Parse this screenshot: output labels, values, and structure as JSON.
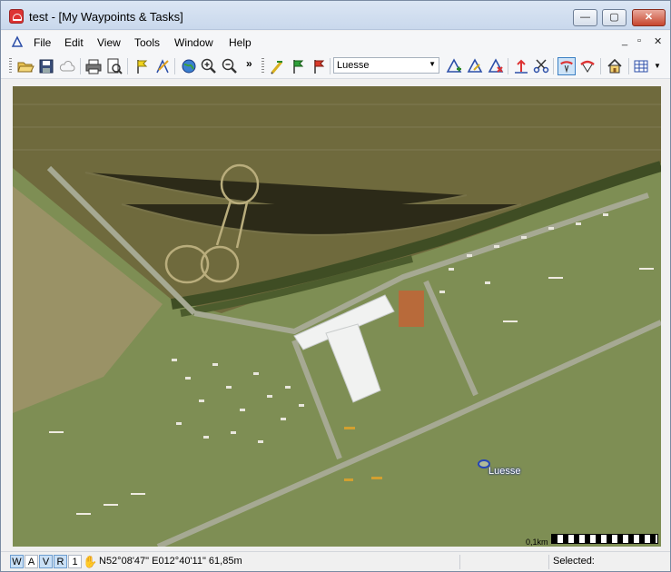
{
  "window": {
    "title": "test - [My Waypoints & Tasks]",
    "controls": {
      "minimize": "—",
      "maximize": "▢",
      "close": "✕"
    }
  },
  "menubar": {
    "items": [
      "File",
      "Edit",
      "View",
      "Tools",
      "Window",
      "Help"
    ],
    "mdi_controls": {
      "minimize": "_",
      "restore": "▫",
      "close": "✕"
    }
  },
  "toolbar": {
    "waypoint_select": "Luesse",
    "overflow": "»"
  },
  "map": {
    "waypoint_label": "Luesse",
    "scale_label": "0,1km"
  },
  "statusbar": {
    "toggles": [
      "W",
      "A",
      "V",
      "R",
      "1"
    ],
    "coordinates": "N52°08'47\"  E012°40'11\" 61,85m",
    "selected_label": "Selected:"
  },
  "colors": {
    "field_dark": "#6b6a3a",
    "field_light": "#8a8a5a",
    "grass": "#7d8f52",
    "road": "#a9ad9a",
    "building": "#eef0f2",
    "accent_blue": "#2646b8"
  }
}
